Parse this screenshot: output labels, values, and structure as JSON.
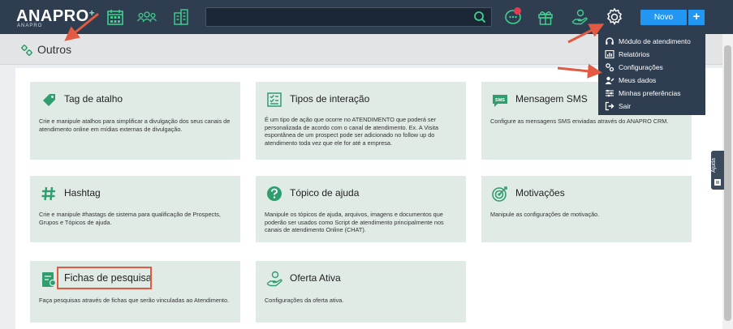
{
  "brand": {
    "name": "ANAPRO",
    "plus": "+",
    "sub": "ANAPRO"
  },
  "header": {
    "new_button": "Novo",
    "add_button": "+",
    "search_placeholder": ""
  },
  "page": {
    "title": "Outros"
  },
  "cards": [
    {
      "title": "Tag de atalho",
      "desc": "Crie e manipule atalhos para simplificar a divulgação dos seus canais de atendimento online em mídias externas de divulgação."
    },
    {
      "title": "Tipos de interação",
      "desc": "É um tipo de ação que ocorre no ATENDIMENTO que poderá ser personalizada de acordo com o canal de atendimento. Ex. A Visita espontânea de um prospect pode ser adicionado no follow up do atendimento toda vez que ele for até a empresa."
    },
    {
      "title": "Mensagem SMS",
      "desc": "Configure as mensagens SMS enviadas através do ANAPRO CRM.",
      "icon_text": "SMS"
    },
    {
      "title": "Hashtag",
      "desc": "Crie e manipule #hastags de sistema para qualificação de Prospects, Grupos e Tópicos de ajuda."
    },
    {
      "title": "Tópico de ajuda",
      "desc": "Manipule os tópicos de ajuda, arquivos, imagens e documentos que poderão ser usados como Script de atendimento principalmente nos canais de atendimento Online (CHAT)."
    },
    {
      "title": "Motivações",
      "desc": "Manipule as configurações de motivação."
    },
    {
      "title": "Fichas de pesquisa",
      "desc": "Faça pesquisas através de fichas que serão vinculadas ao Atendimento."
    },
    {
      "title": "Oferta Ativa",
      "desc": "Configurações da oferta ativa."
    }
  ],
  "menu": {
    "items": [
      {
        "label": "Módulo de atendimento",
        "icon": "headset-icon"
      },
      {
        "label": "Relatórios",
        "icon": "report-icon"
      },
      {
        "label": "Configurações",
        "icon": "gears-icon"
      },
      {
        "label": "Meus dados",
        "icon": "user-edit-icon"
      },
      {
        "label": "Minhas preferências",
        "icon": "sliders-icon"
      },
      {
        "label": "Sair",
        "icon": "logout-icon"
      }
    ]
  },
  "help_tab": {
    "label": "Ajuda"
  },
  "colors": {
    "topbar": "#2e3e50",
    "accent": "#2196f3",
    "card_bg": "#e0ebe6",
    "icon_green": "#2e9e6e",
    "highlight": "#e35a43"
  }
}
